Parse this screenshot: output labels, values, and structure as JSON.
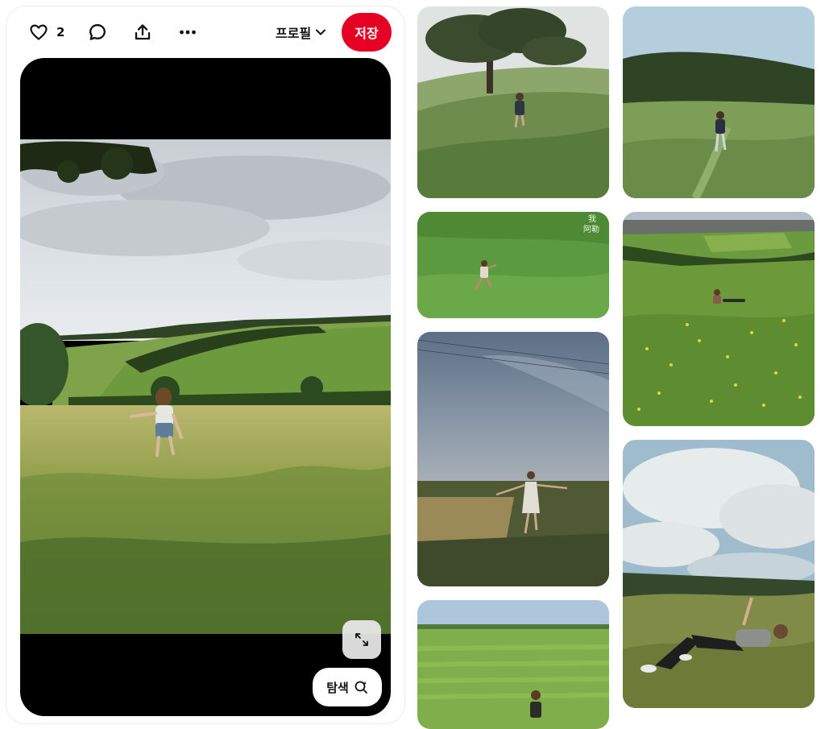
{
  "toolbar": {
    "like_count": "2",
    "profile_label": "프로필",
    "save_label": "저장"
  },
  "media": {
    "search_label": "탐색"
  },
  "grid": {
    "pins": [
      {
        "name": "pin-tree-meadow-runner"
      },
      {
        "name": "pin-hill-grass-runner"
      },
      {
        "name": "pin-green-field-runner"
      },
      {
        "name": "pin-valley-flowers"
      },
      {
        "name": "pin-dusk-field-dancer"
      },
      {
        "name": "pin-sky-lying-grass"
      },
      {
        "name": "pin-flat-field"
      }
    ],
    "watermark_text": [
      "我",
      "阿勒"
    ]
  },
  "colors": {
    "save_red": "#e60023",
    "text": "#111111"
  },
  "icons": [
    "heart-icon",
    "comment-icon",
    "share-icon",
    "more-icon",
    "chevron-down-icon",
    "expand-icon",
    "visual-search-icon"
  ]
}
